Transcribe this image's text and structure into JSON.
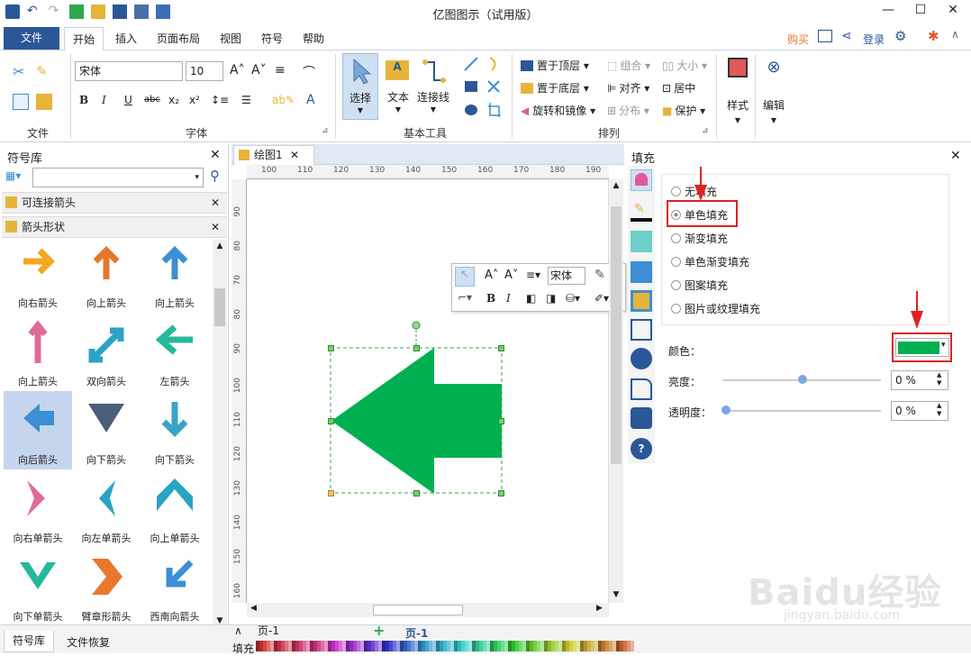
{
  "app": {
    "title": "亿图图示（试用版）"
  },
  "menu": {
    "file": "文件",
    "tabs": [
      "开始",
      "插入",
      "页面布局",
      "视图",
      "符号",
      "帮助"
    ],
    "active_tab": "开始",
    "buy": "购买",
    "login": "登录"
  },
  "ribbon": {
    "groups": {
      "file": "文件",
      "font": "字体",
      "basic_tools": "基本工具",
      "arrange": "排列"
    },
    "font_name": "宋体",
    "font_size": "10",
    "select": "选择",
    "text": "文本",
    "connector": "连接线",
    "bring_front": "置于顶层",
    "send_back": "置于底层",
    "rotate_mirror": "旋转和镜像",
    "group": "组合",
    "align": "对齐",
    "distribute": "分布",
    "size": "大小",
    "center": "居中",
    "protect": "保护",
    "style": "样式",
    "edit": "编辑"
  },
  "library": {
    "title": "符号库",
    "sections": [
      "可连接箭头",
      "箭头形状"
    ],
    "symbols": [
      {
        "label": "向右箭头",
        "color": "#f5a623"
      },
      {
        "label": "向上箭头",
        "color": "#e8772e"
      },
      {
        "label": "向上箭头",
        "color": "#3c8fd4"
      },
      {
        "label": "向上箭头",
        "color": "#e06a9a"
      },
      {
        "label": "双向箭头",
        "color": "#2aa3c4"
      },
      {
        "label": "左箭头",
        "color": "#26b89a"
      },
      {
        "label": "向后箭头",
        "color": "#3c8fd4"
      },
      {
        "label": "向下箭头",
        "color": "#4a5e7a"
      },
      {
        "label": "向下箭头",
        "color": "#3ba3c9"
      },
      {
        "label": "向右单箭头",
        "color": "#e06a9a"
      },
      {
        "label": "向左单箭头",
        "color": "#2aa3c4"
      },
      {
        "label": "向上单箭头",
        "color": "#2aa3c4"
      },
      {
        "label": "向下单箭头",
        "color": "#26b89a"
      },
      {
        "label": "臂章形箭头",
        "color": "#e8772e"
      },
      {
        "label": "西南向箭头",
        "color": "#3c8fd4"
      }
    ]
  },
  "canvas": {
    "tab": "绘图1",
    "hruler": [
      "100",
      "110",
      "120",
      "130",
      "140",
      "150",
      "160",
      "170",
      "180",
      "190"
    ],
    "vruler": [
      "90",
      "80",
      "70",
      "80",
      "90",
      "100",
      "110",
      "120",
      "130",
      "140",
      "150",
      "160"
    ],
    "shape_color": "#00b050",
    "float_font": "宋体"
  },
  "fill_panel": {
    "title": "填充",
    "options": [
      "无填充",
      "单色填充",
      "渐变填充",
      "单色渐变填充",
      "图案填充",
      "图片或纹理填充"
    ],
    "selected": "单色填充",
    "color_label": "颜色：",
    "color_value": "#00b050",
    "brightness_label": "亮度：",
    "brightness_value": "0 %",
    "transparency_label": "透明度：",
    "transparency_value": "0 %"
  },
  "bottom": {
    "page_label": "页-1",
    "active_page": "页-1",
    "lib_tab": "符号库",
    "recover_tab": "文件恢复",
    "fill_label": "填充"
  },
  "watermark": {
    "text": "Baidu经验",
    "url": "jingyan.baidu.com"
  }
}
